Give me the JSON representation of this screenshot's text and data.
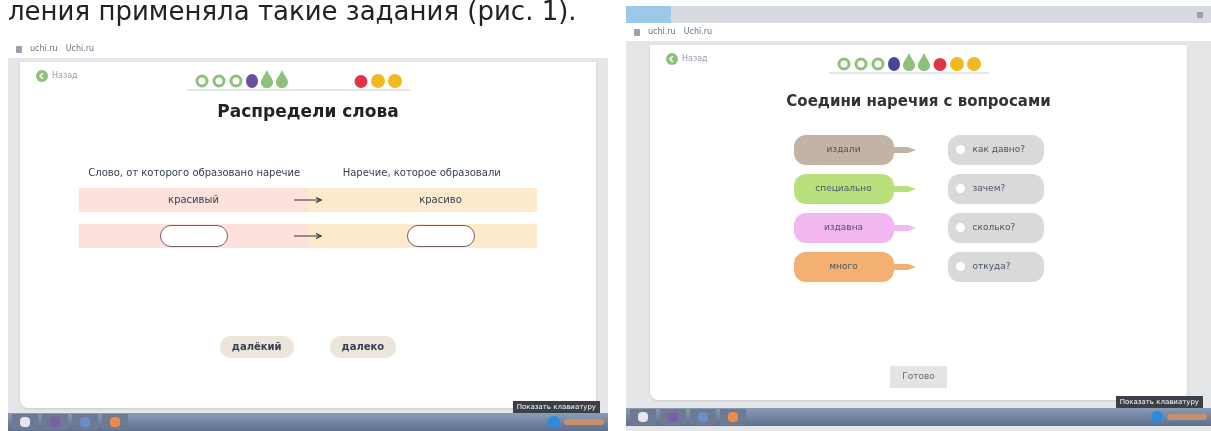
{
  "caption": "ления применяла такие задания (рис. 1).",
  "left": {
    "address": [
      "uchi.ru",
      "Uchi.ru"
    ],
    "back": "Назад",
    "progress": [
      {
        "kind": "circle",
        "color": "#8dc07a"
      },
      {
        "kind": "circle",
        "color": "#8dc07a"
      },
      {
        "kind": "circle",
        "color": "#8dc07a"
      },
      {
        "kind": "plum",
        "color": "#6b4f9e"
      },
      {
        "kind": "pear",
        "color": "#8dc07a"
      },
      {
        "kind": "pear",
        "color": "#8dc07a"
      },
      {
        "kind": "gap"
      },
      {
        "kind": "apple",
        "color": "#e2334a"
      },
      {
        "kind": "lemon",
        "color": "#f2b81f"
      },
      {
        "kind": "lemon",
        "color": "#f2b81f"
      }
    ],
    "title": "Распредели слова",
    "columns": [
      "Слово, от которого образовано наречие",
      "Наречие, которое образовали"
    ],
    "rows": [
      {
        "from": "красивый",
        "to": "красиво"
      },
      {
        "from": "",
        "to": ""
      }
    ],
    "words": [
      "далёкий",
      "далеко"
    ],
    "tooltip": "Показать клавиатуру"
  },
  "right": {
    "address": [
      "uchi.ru",
      "Uchi.ru"
    ],
    "back": "Назад",
    "progress": [
      {
        "kind": "circle",
        "color": "#8dc07a"
      },
      {
        "kind": "circle",
        "color": "#8dc07a"
      },
      {
        "kind": "circle",
        "color": "#8dc07a"
      },
      {
        "kind": "plum",
        "color": "#4b4598"
      },
      {
        "kind": "pear",
        "color": "#8dc07a"
      },
      {
        "kind": "pear",
        "color": "#8dc07a"
      },
      {
        "kind": "apple",
        "color": "#e2334a"
      },
      {
        "kind": "lemon",
        "color": "#f2b81f"
      },
      {
        "kind": "lemon",
        "color": "#f2b81f"
      }
    ],
    "title": "Соедини наречия с вопросами",
    "pairs": [
      {
        "word": "издали",
        "color": "#c3b3a5",
        "question": "как давно?"
      },
      {
        "word": "специально",
        "color": "#b9e07d",
        "question": "зачем?"
      },
      {
        "word": "издавна",
        "color": "#f2b6f0",
        "question": "сколько?"
      },
      {
        "word": "много",
        "color": "#f3b072",
        "question": "откуда?"
      }
    ],
    "button": "Готово",
    "tooltip": "Показать клавиатуру"
  }
}
